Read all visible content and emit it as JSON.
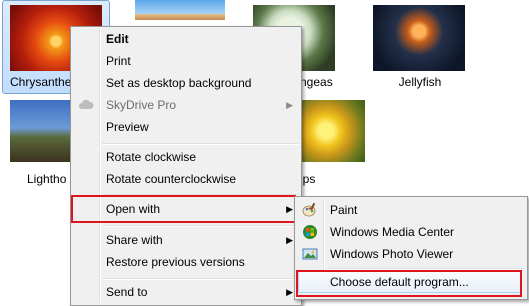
{
  "files": [
    {
      "name": "Chrysanthemum",
      "label": "Chrysanthe",
      "selected": true
    },
    {
      "name": "Desert",
      "label": ""
    },
    {
      "name": "Hydrangeas",
      "label": "ngeas"
    },
    {
      "name": "Jellyfish",
      "label": "Jellyfish"
    },
    {
      "name": "Lighthouse",
      "label": "Lightho"
    },
    {
      "name": "Tulips",
      "label": "ips"
    }
  ],
  "context_menu": {
    "items": [
      {
        "label": "Edit",
        "bold": true
      },
      {
        "label": "Print"
      },
      {
        "label": "Set as desktop background"
      },
      {
        "label": "SkyDrive Pro",
        "disabled": true,
        "submenu": true,
        "icon": "cloud-icon"
      },
      {
        "label": "Preview"
      },
      {
        "label": "Rotate clockwise"
      },
      {
        "label": "Rotate counterclockwise"
      },
      {
        "label": "Open with",
        "submenu": true,
        "highlighted": true
      },
      {
        "label": "Share with",
        "submenu": true
      },
      {
        "label": "Restore previous versions"
      },
      {
        "label": "Send to",
        "submenu": true
      }
    ],
    "submenu_arrow": "▶"
  },
  "open_with_menu": {
    "items": [
      {
        "label": "Paint",
        "icon": "paint-icon"
      },
      {
        "label": "Windows Media Center",
        "icon": "media-center-icon"
      },
      {
        "label": "Windows Photo Viewer",
        "icon": "photo-viewer-icon"
      },
      {
        "label": "Choose default program...",
        "highlighted": true
      }
    ]
  },
  "colors": {
    "highlight_border": "#e0141e",
    "menu_background": "#f0f0f0",
    "selection_blue": "#c1dcfc"
  }
}
